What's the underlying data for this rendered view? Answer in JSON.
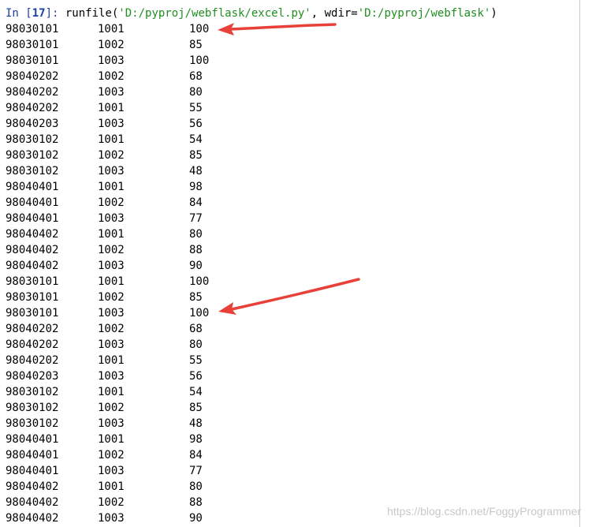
{
  "console": {
    "prompt": {
      "prefix": "In [",
      "number": "17",
      "suffix": "]:",
      "call_name": " runfile(",
      "arg1": "'D:/pyproj/webflask/excel.py'",
      "separator": ", wdir=",
      "arg2": "'D:/pyproj/webflask'",
      "close": ")"
    },
    "rows": [
      [
        "98030101",
        "1001",
        "100"
      ],
      [
        "98030101",
        "1002",
        "85"
      ],
      [
        "98030101",
        "1003",
        "100"
      ],
      [
        "98040202",
        "1002",
        "68"
      ],
      [
        "98040202",
        "1003",
        "80"
      ],
      [
        "98040202",
        "1001",
        "55"
      ],
      [
        "98040203",
        "1003",
        "56"
      ],
      [
        "98030102",
        "1001",
        "54"
      ],
      [
        "98030102",
        "1002",
        "85"
      ],
      [
        "98030102",
        "1003",
        "48"
      ],
      [
        "98040401",
        "1001",
        "98"
      ],
      [
        "98040401",
        "1002",
        "84"
      ],
      [
        "98040401",
        "1003",
        "77"
      ],
      [
        "98040402",
        "1001",
        "80"
      ],
      [
        "98040402",
        "1002",
        "88"
      ],
      [
        "98040402",
        "1003",
        "90"
      ],
      [
        "98030101",
        "1001",
        "100"
      ],
      [
        "98030101",
        "1002",
        "85"
      ],
      [
        "98030101",
        "1003",
        "100"
      ],
      [
        "98040202",
        "1002",
        "68"
      ],
      [
        "98040202",
        "1003",
        "80"
      ],
      [
        "98040202",
        "1001",
        "55"
      ],
      [
        "98040203",
        "1003",
        "56"
      ],
      [
        "98030102",
        "1001",
        "54"
      ],
      [
        "98030102",
        "1002",
        "85"
      ],
      [
        "98030102",
        "1003",
        "48"
      ],
      [
        "98040401",
        "1001",
        "98"
      ],
      [
        "98040401",
        "1002",
        "84"
      ],
      [
        "98040401",
        "1003",
        "77"
      ],
      [
        "98040402",
        "1001",
        "80"
      ],
      [
        "98040402",
        "1002",
        "88"
      ],
      [
        "98040402",
        "1003",
        "90"
      ]
    ]
  },
  "watermark": "https://blog.csdn.net/FoggyProgrammer",
  "colors": {
    "prompt": "#1c3fa8",
    "string": "#1f8f1f",
    "arrow": "#e8413a"
  },
  "annotations": [
    "red-arrow-icon",
    "red-arrow-icon"
  ]
}
